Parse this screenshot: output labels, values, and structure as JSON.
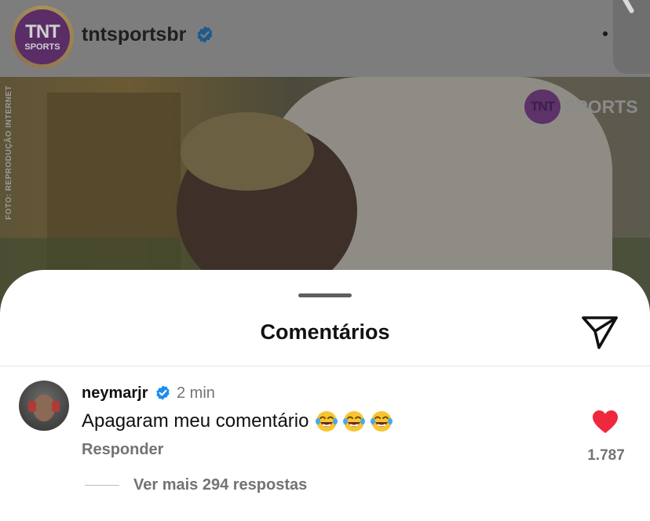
{
  "post": {
    "account": {
      "username": "tntsportsbr",
      "avatar_text_line1": "TNT",
      "avatar_text_line2": "SPORTS",
      "verified": true
    },
    "photo": {
      "credit": "FOTO: REPRODUÇÃO INTERNET",
      "watermark_badge": "TNT",
      "watermark_word": "SPORTS"
    }
  },
  "sheet": {
    "title": "Comentários"
  },
  "comments": [
    {
      "username": "neymarjr",
      "verified": true,
      "time": "2 min",
      "text": "Apagaram meu comentário",
      "emoji": [
        "tears-of-joy",
        "tears-of-joy",
        "tears-of-joy"
      ],
      "reply_label": "Responder",
      "liked": true,
      "like_count": "1.787",
      "view_replies": "Ver mais 294 respostas"
    }
  ],
  "colors": {
    "verified_blue": "#1d8cf0",
    "like_red": "#f0283e",
    "secondary_text": "#737373"
  },
  "icons": {
    "verified": "verified-badge-icon",
    "send": "paper-plane-icon",
    "like": "heart-icon",
    "more": "more-dots-icon"
  }
}
